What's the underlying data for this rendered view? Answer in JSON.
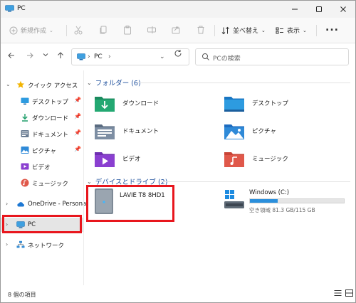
{
  "window": {
    "title": "PC"
  },
  "commandbar": {
    "new_label": "新規作成",
    "sort_label": "並べ替え",
    "view_label": "表示",
    "more_label": "..."
  },
  "address": {
    "location": "PC"
  },
  "search": {
    "placeholder": "PCの検索"
  },
  "sidebar": {
    "quick_access": "クイック アクセス",
    "items": [
      {
        "label": "デスクトップ",
        "icon": "desktop-folder-icon",
        "pinned": true
      },
      {
        "label": "ダウンロード",
        "icon": "download-folder-icon",
        "pinned": true
      },
      {
        "label": "ドキュメント",
        "icon": "documents-folder-icon",
        "pinned": true
      },
      {
        "label": "ピクチャ",
        "icon": "pictures-folder-icon",
        "pinned": true
      },
      {
        "label": "ビデオ",
        "icon": "videos-folder-icon",
        "pinned": false
      },
      {
        "label": "ミュージック",
        "icon": "music-folder-icon",
        "pinned": false
      }
    ],
    "onedrive": "OneDrive - Personal",
    "pc": "PC",
    "network": "ネットワーク"
  },
  "main": {
    "folders_header": "フォルダー (6)",
    "folders": [
      {
        "label": "ダウンロード",
        "icon": "download-folder-icon"
      },
      {
        "label": "デスクトップ",
        "icon": "desktop-folder-icon"
      },
      {
        "label": "ドキュメント",
        "icon": "documents-folder-icon"
      },
      {
        "label": "ピクチャ",
        "icon": "pictures-folder-icon"
      },
      {
        "label": "ビデオ",
        "icon": "videos-folder-icon"
      },
      {
        "label": "ミュージック",
        "icon": "music-folder-icon"
      }
    ],
    "drives_header": "デバイスとドライブ (2)",
    "drives": [
      {
        "label": "LAVIE T8 8HD1",
        "icon": "tablet-device-icon"
      },
      {
        "label": "Windows (C:)",
        "icon": "windows-drive-icon",
        "free_text": "空き領域 81.3 GB/115 GB",
        "used_fraction": 0.293
      }
    ]
  },
  "status": {
    "item_count": "8 個の項目"
  },
  "colors": {
    "accent": "#1d4f9c",
    "highlight": "#e8161d",
    "usage_bar": "#2a8fdc"
  }
}
